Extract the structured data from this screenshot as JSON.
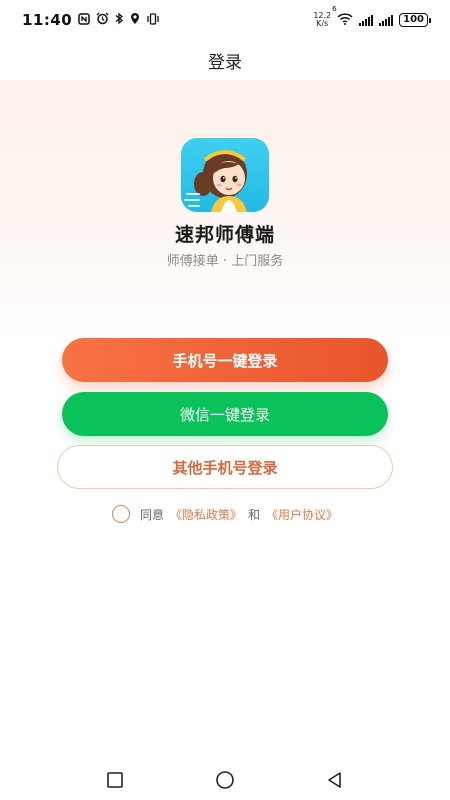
{
  "status_bar": {
    "time": "11:40",
    "net_speed_value": "12.2",
    "net_speed_unit": "K/s",
    "wifi_badge": "6",
    "battery": "100"
  },
  "header": {
    "title": "登录"
  },
  "brand": {
    "app_name": "速邦师傅端",
    "slogan": "师傅接单 · 上门服务"
  },
  "buttons": {
    "phone_login": "手机号一键登录",
    "wechat_login": "微信一键登录",
    "other_phone_login": "其他手机号登录"
  },
  "agreement": {
    "prefix": "同意",
    "privacy": "《隐私政策》",
    "and": "和",
    "user_agreement": "《用户协议》",
    "checked": false
  },
  "colors": {
    "primary": "#f26a3b",
    "wechat": "#0ac25a",
    "link": "#e07a4a"
  },
  "icons": [
    "nfc-icon",
    "alarm-icon",
    "bluetooth-icon",
    "location-icon",
    "vibrate-icon",
    "wifi-icon",
    "signal-icon",
    "battery-icon",
    "recent-apps-icon",
    "home-icon",
    "back-icon"
  ]
}
